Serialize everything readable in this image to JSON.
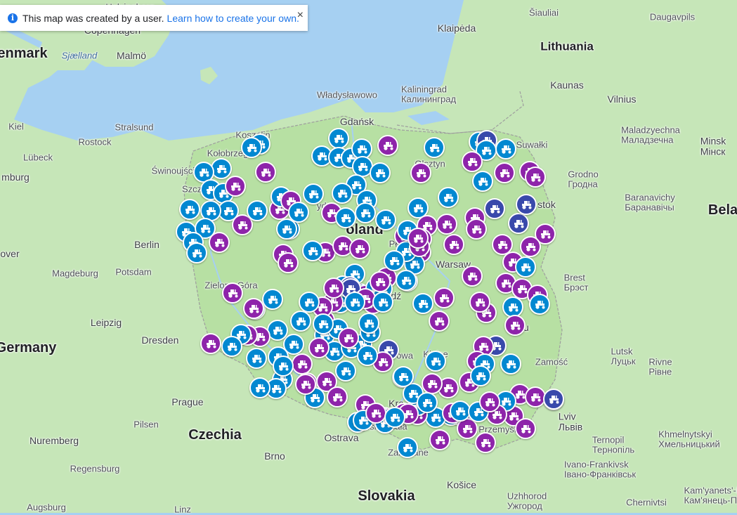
{
  "notice": {
    "text": "This map was created by a user.",
    "link": "Learn how to create your own.",
    "close": "×",
    "info_icon": "i"
  },
  "colors": {
    "water": "#a6d0f2",
    "land": "#c6e6b8",
    "poland": "#b7e0a3",
    "marker_purple": "#8e24aa",
    "marker_blue": "#0288d1",
    "marker_navy": "#3949ab"
  },
  "labels": [
    {
      "id": "denmark",
      "text": "enmark",
      "cls": "country"
    },
    {
      "id": "copenhagen",
      "text": "Copenhagen",
      "cls": "city"
    },
    {
      "id": "malmo",
      "text": "Malmö",
      "cls": "city"
    },
    {
      "id": "sjaelland",
      "text": "Sjælland",
      "cls": "water"
    },
    {
      "id": "helsingborg",
      "text": "Helsingborg",
      "cls": "small"
    },
    {
      "id": "kiel",
      "text": "Kiel",
      "cls": "small"
    },
    {
      "id": "stralsund",
      "text": "Stralsund",
      "cls": "small"
    },
    {
      "id": "rostock",
      "text": "Rostock",
      "cls": "small"
    },
    {
      "id": "lubeck",
      "text": "Lübeck",
      "cls": "small"
    },
    {
      "id": "hamburg",
      "text": "mburg",
      "cls": "city"
    },
    {
      "id": "swinoujscie",
      "text": "Świnoujście",
      "cls": "small"
    },
    {
      "id": "koszalin",
      "text": "Koszalin",
      "cls": "small"
    },
    {
      "id": "kolobrzeg",
      "text": "Kołobrzeg",
      "cls": "small"
    },
    {
      "id": "szczecin",
      "text": "Szczecin",
      "cls": "small"
    },
    {
      "id": "berlin",
      "text": "Berlin",
      "cls": "city"
    },
    {
      "id": "potsdam",
      "text": "Potsdam",
      "cls": "small"
    },
    {
      "id": "magdeburg",
      "text": "Magdeburg",
      "cls": "small"
    },
    {
      "id": "hanover",
      "text": "over",
      "cls": "city"
    },
    {
      "id": "leipzig",
      "text": "Leipzig",
      "cls": "city"
    },
    {
      "id": "dresden",
      "text": "Dresden",
      "cls": "city"
    },
    {
      "id": "germany",
      "text": "Germany",
      "cls": "country"
    },
    {
      "id": "zielona",
      "text": "Zielona Góra",
      "cls": "small"
    },
    {
      "id": "prague",
      "text": "Prague",
      "cls": "city"
    },
    {
      "id": "czechia",
      "text": "Czechia",
      "cls": "country"
    },
    {
      "id": "pilsen",
      "text": "Pilsen",
      "cls": "small"
    },
    {
      "id": "nuremberg",
      "text": "Nuremberg",
      "cls": "city"
    },
    {
      "id": "regensburg",
      "text": "Regensburg",
      "cls": "small"
    },
    {
      "id": "augsburg",
      "text": "Augsburg",
      "cls": "small"
    },
    {
      "id": "linz",
      "text": "Linz",
      "cls": "small"
    },
    {
      "id": "brno",
      "text": "Brno",
      "cls": "city"
    },
    {
      "id": "ostrava",
      "text": "Ostrava",
      "cls": "city"
    },
    {
      "id": "slovakia",
      "text": "Slovakia",
      "cls": "country"
    },
    {
      "id": "kosice",
      "text": "Košice",
      "cls": "city"
    },
    {
      "id": "uzhhorod",
      "text": "Uzhhorod",
      "alt": "Ужгород",
      "cls": "small"
    },
    {
      "id": "gdansk",
      "text": "Gdańsk",
      "cls": "city"
    },
    {
      "id": "wladyslawowo",
      "text": "Władysławowo",
      "cls": "small"
    },
    {
      "id": "kaliningrad",
      "text": "Kaliningrad",
      "alt": "Калининград",
      "cls": "small"
    },
    {
      "id": "klaipeda",
      "text": "Klaipėda",
      "cls": "city"
    },
    {
      "id": "siauliai",
      "text": "Šiauliai",
      "cls": "small"
    },
    {
      "id": "daugavpils",
      "text": "Daugavpils",
      "cls": "small"
    },
    {
      "id": "lithuania",
      "text": "Lithuania",
      "cls": "big"
    },
    {
      "id": "kaunas",
      "text": "Kaunas",
      "cls": "city"
    },
    {
      "id": "vilnius",
      "text": "Vilnius",
      "cls": "city"
    },
    {
      "id": "suwalki",
      "text": "Suwałki",
      "cls": "small"
    },
    {
      "id": "olsztyn",
      "text": "Olsztyn",
      "cls": "small"
    },
    {
      "id": "molodechno",
      "text": "Maladzyechna",
      "alt": "Маладзечна",
      "cls": "small"
    },
    {
      "id": "minsk",
      "text": "Minsk",
      "alt": "Мінск",
      "cls": "city"
    },
    {
      "id": "belarus",
      "text": "Bela",
      "cls": "country"
    },
    {
      "id": "grodno",
      "text": "Grodno",
      "alt": "Гродна",
      "cls": "small"
    },
    {
      "id": "baranovichi",
      "text": "Baranavichy",
      "alt": "Баранавічы",
      "cls": "small"
    },
    {
      "id": "bialystok",
      "text": "stok",
      "cls": "city"
    },
    {
      "id": "bydgoszcz",
      "text": "ydgo",
      "cls": "small"
    },
    {
      "id": "poland",
      "text": "oland",
      "cls": "country"
    },
    {
      "id": "plock",
      "text": "Pło",
      "cls": "small"
    },
    {
      "id": "warsaw",
      "text": "Warsaw",
      "cls": "city"
    },
    {
      "id": "lodz",
      "text": "Łódź",
      "cls": "city"
    },
    {
      "id": "brest",
      "text": "Brest",
      "alt": "Брэст",
      "cls": "small"
    },
    {
      "id": "lublin",
      "text": "Lu",
      "cls": "city"
    },
    {
      "id": "kielce",
      "text": "Kielce",
      "cls": "small"
    },
    {
      "id": "lutsk",
      "text": "Lutsk",
      "alt": "Луцьк",
      "cls": "small"
    },
    {
      "id": "rivne",
      "text": "Rivne",
      "alt": "Рівне",
      "cls": "small"
    },
    {
      "id": "zamosc",
      "text": "Zamość",
      "cls": "small"
    },
    {
      "id": "lviv",
      "text": "Lviv",
      "alt": "Львів",
      "cls": "city"
    },
    {
      "id": "ternopil",
      "text": "Ternopil",
      "alt": "Тернопіль",
      "cls": "small"
    },
    {
      "id": "khmelnytskyi",
      "text": "Khmelnytskyi",
      "alt": "Хмельницький",
      "cls": "small"
    },
    {
      "id": "ivanofrankivsk",
      "text": "Ivano-Frankivsk",
      "alt": "Івано-Франківськ",
      "cls": "small"
    },
    {
      "id": "kamianets",
      "text": "Kam'yanets'-P",
      "alt": "Кам'янець-П",
      "cls": "small"
    },
    {
      "id": "chernivtsi",
      "text": "Chernivtsi",
      "cls": "small"
    },
    {
      "id": "krakow",
      "text": "Kra",
      "cls": "city"
    },
    {
      "id": "katowice",
      "text": "owa",
      "cls": "small"
    },
    {
      "id": "bielsko",
      "text": "Bielsko-Biała",
      "cls": "small"
    },
    {
      "id": "przemysl",
      "text": "Przemyśl",
      "cls": "small"
    },
    {
      "id": "zakopane",
      "text": "Zakopane",
      "cls": "small"
    }
  ],
  "markers": [
    {
      "c": "b"
    },
    {
      "c": "b"
    },
    {
      "c": "b"
    },
    {
      "c": "b"
    },
    {
      "c": "b"
    },
    {
      "c": "b"
    },
    {
      "c": "b"
    },
    {
      "c": "b"
    },
    {
      "c": "b"
    },
    {
      "c": "b"
    },
    {
      "c": "b"
    },
    {
      "c": "b"
    },
    {
      "c": "b"
    },
    {
      "c": "p"
    },
    {
      "c": "p"
    },
    {
      "c": "p"
    },
    {
      "c": "b"
    },
    {
      "c": "p"
    },
    {
      "c": "p"
    },
    {
      "c": "b"
    },
    {
      "c": "b"
    },
    {
      "c": "b"
    },
    {
      "c": "b"
    },
    {
      "c": "b"
    },
    {
      "c": "b"
    },
    {
      "c": "b"
    },
    {
      "c": "b"
    },
    {
      "c": "b"
    },
    {
      "c": "p"
    },
    {
      "c": "b"
    },
    {
      "c": "b"
    },
    {
      "c": "p"
    },
    {
      "c": "b"
    },
    {
      "c": "b"
    },
    {
      "c": "b"
    },
    {
      "c": "b"
    },
    {
      "c": "b"
    },
    {
      "c": "b"
    },
    {
      "c": "b"
    },
    {
      "c": "p"
    },
    {
      "c": "p"
    },
    {
      "c": "b"
    },
    {
      "c": "b"
    },
    {
      "c": "b"
    },
    {
      "c": "n"
    },
    {
      "c": "n"
    },
    {
      "c": "n"
    },
    {
      "c": "p"
    },
    {
      "c": "b"
    },
    {
      "c": "p"
    },
    {
      "c": "p"
    },
    {
      "c": "b"
    },
    {
      "c": "b"
    },
    {
      "c": "p"
    },
    {
      "c": "p"
    },
    {
      "c": "p"
    },
    {
      "c": "p"
    },
    {
      "c": "p"
    },
    {
      "c": "p"
    },
    {
      "c": "p"
    },
    {
      "c": "p"
    },
    {
      "c": "n"
    },
    {
      "c": "p"
    },
    {
      "c": "p"
    },
    {
      "c": "p"
    },
    {
      "c": "p"
    },
    {
      "c": "p"
    },
    {
      "c": "p"
    },
    {
      "c": "p"
    },
    {
      "c": "p"
    },
    {
      "c": "b"
    },
    {
      "c": "b"
    },
    {
      "c": "p"
    },
    {
      "c": "p"
    },
    {
      "c": "p"
    },
    {
      "c": "b"
    },
    {
      "c": "b"
    },
    {
      "c": "b"
    },
    {
      "c": "p"
    },
    {
      "c": "p"
    },
    {
      "c": "p"
    },
    {
      "c": "n"
    },
    {
      "c": "p"
    },
    {
      "c": "b"
    },
    {
      "c": "b"
    },
    {
      "c": "p"
    },
    {
      "c": "p"
    },
    {
      "c": "b"
    },
    {
      "c": "p"
    },
    {
      "c": "b"
    },
    {
      "c": "p"
    },
    {
      "c": "p"
    },
    {
      "c": "p"
    },
    {
      "c": "p"
    },
    {
      "c": "b"
    },
    {
      "c": "b"
    },
    {
      "c": "p"
    },
    {
      "c": "n"
    },
    {
      "c": "p"
    },
    {
      "c": "p"
    },
    {
      "c": "p"
    },
    {
      "c": "b"
    },
    {
      "c": "p"
    },
    {
      "c": "b"
    },
    {
      "c": "b"
    },
    {
      "c": "p"
    },
    {
      "c": "p"
    },
    {
      "c": "b"
    },
    {
      "c": "p"
    },
    {
      "c": "p"
    },
    {
      "c": "b"
    },
    {
      "c": "n"
    },
    {
      "c": "b"
    },
    {
      "c": "b"
    },
    {
      "c": "p"
    },
    {
      "c": "p"
    },
    {
      "c": "n"
    },
    {
      "c": "b"
    },
    {
      "c": "b"
    },
    {
      "c": "p"
    },
    {
      "c": "b"
    },
    {
      "c": "p"
    },
    {
      "c": "p"
    },
    {
      "c": "b"
    },
    {
      "c": "b"
    },
    {
      "c": "p"
    },
    {
      "c": "p"
    },
    {
      "c": "p"
    },
    {
      "c": "b"
    },
    {
      "c": "b"
    },
    {
      "c": "b"
    },
    {
      "c": "b"
    },
    {
      "c": "b"
    },
    {
      "c": "b"
    },
    {
      "c": "b"
    },
    {
      "c": "p"
    },
    {
      "c": "p"
    },
    {
      "c": "p"
    },
    {
      "c": "b"
    },
    {
      "c": "p"
    },
    {
      "c": "b"
    },
    {
      "c": "p"
    },
    {
      "c": "b"
    },
    {
      "c": "b"
    },
    {
      "c": "b"
    },
    {
      "c": "b"
    },
    {
      "c": "p"
    },
    {
      "c": "p"
    },
    {
      "c": "b"
    },
    {
      "c": "b"
    },
    {
      "c": "p"
    },
    {
      "c": "b"
    },
    {
      "c": "b"
    },
    {
      "c": "b"
    },
    {
      "c": "p"
    },
    {
      "c": "b"
    },
    {
      "c": "b"
    },
    {
      "c": "n"
    },
    {
      "c": "p"
    },
    {
      "c": "p"
    },
    {
      "c": "p"
    },
    {
      "c": "b"
    },
    {
      "c": "p"
    },
    {
      "c": "p"
    },
    {
      "c": "b"
    },
    {
      "c": "b"
    },
    {
      "c": "b"
    },
    {
      "c": "p"
    },
    {
      "c": "p"
    },
    {
      "c": "b"
    },
    {
      "c": "b"
    },
    {
      "c": "b"
    },
    {
      "c": "b"
    },
    {
      "c": "p"
    },
    {
      "c": "p"
    },
    {
      "c": "b"
    },
    {
      "c": "p"
    },
    {
      "c": "b"
    },
    {
      "c": "b"
    },
    {
      "c": "p"
    },
    {
      "c": "b"
    },
    {
      "c": "p"
    },
    {
      "c": "b"
    },
    {
      "c": "b"
    },
    {
      "c": "p"
    },
    {
      "c": "b"
    },
    {
      "c": "p"
    },
    {
      "c": "b"
    },
    {
      "c": "n"
    },
    {
      "c": "p"
    },
    {
      "c": "b"
    },
    {
      "c": "p"
    },
    {
      "c": "b"
    },
    {
      "c": "b"
    },
    {
      "c": "b"
    },
    {
      "c": "p"
    },
    {
      "c": "b"
    },
    {
      "c": "p"
    },
    {
      "c": "b"
    },
    {
      "c": "b"
    }
  ]
}
